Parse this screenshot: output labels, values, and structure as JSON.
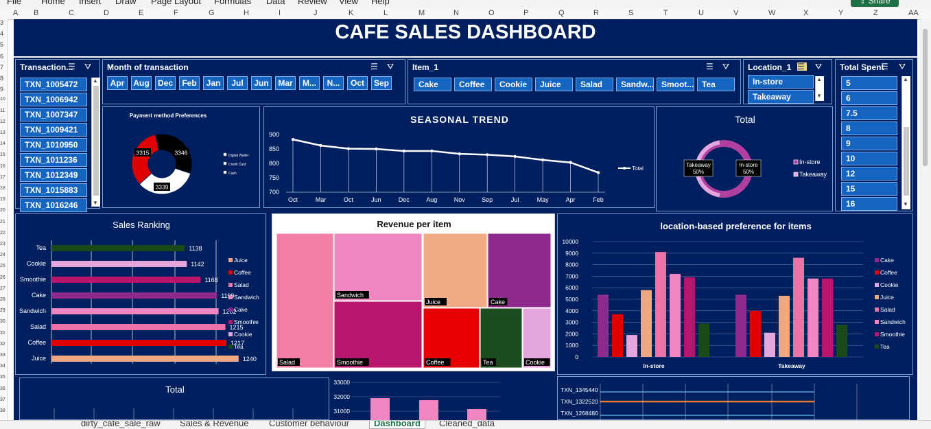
{
  "ribbon": {
    "tabs": [
      "File",
      "Home",
      "Insert",
      "Draw",
      "Page Layout",
      "Formulas",
      "Data",
      "Review",
      "View",
      "Help"
    ],
    "share": "Share"
  },
  "columns": [
    "A",
    "B",
    "C",
    "D",
    "E",
    "F",
    "G",
    "H",
    "I",
    "J",
    "K",
    "L",
    "M",
    "N",
    "O",
    "P",
    "Q",
    "R",
    "S",
    "T",
    "U",
    "V",
    "W",
    "X",
    "Y",
    "Z",
    "AA"
  ],
  "rows": [
    "3",
    "4",
    "5",
    "6",
    "7",
    "8",
    "9",
    "10",
    "11",
    "12",
    "13",
    "14",
    "15",
    "16",
    "17",
    "18",
    "19",
    "20",
    "21",
    "22",
    "23",
    "24",
    "25",
    "26",
    "27",
    "28",
    "29",
    "30",
    "31",
    "32",
    "33",
    "34",
    "35",
    "36",
    "37",
    "38"
  ],
  "title": "CAFE SALES DASHBOARD",
  "slicers": {
    "transaction": {
      "header": "Transaction...",
      "items": [
        "TXN_1005472",
        "TXN_1006942",
        "TXN_1007347",
        "TXN_1009421",
        "TXN_1010950",
        "TXN_1011236",
        "TXN_1012349",
        "TXN_1015883",
        "TXN_1016246"
      ]
    },
    "month": {
      "header": "Month of transaction",
      "items": [
        "Apr",
        "Aug",
        "Dec",
        "Feb",
        "Jan",
        "Jul",
        "Jun",
        "Mar",
        "M...",
        "N...",
        "Oct",
        "Sep"
      ]
    },
    "item": {
      "header": "Item_1",
      "items": [
        "Cake",
        "Coffee",
        "Cookie",
        "Juice",
        "Salad",
        "Sandw...",
        "Smoot...",
        "Tea"
      ]
    },
    "location": {
      "header": "Location_1",
      "items": [
        "In-store",
        "Takeaway"
      ]
    },
    "total_spent": {
      "header": "Total Spent",
      "items": [
        "5",
        "6",
        "7.5",
        "8",
        "9",
        "10",
        "12",
        "15",
        "16"
      ]
    }
  },
  "payment_chart": {
    "title": "Payment method Preferences",
    "chart_data": {
      "type": "pie",
      "categories": [
        "Digital Wallet",
        "Credit Card",
        "Cash"
      ],
      "values": [
        3315,
        3346,
        3339
      ],
      "colors": [
        "#e00000",
        "#000000",
        "#ffffff"
      ]
    }
  },
  "seasonal_chart": {
    "title": "SEASONAL TREND",
    "chart_data": {
      "type": "line",
      "categories": [
        "Oct",
        "Mar",
        "Oct",
        "Jun",
        "Dec",
        "Aug",
        "Nov",
        "Sep",
        "Jul",
        "May",
        "Apr",
        "Feb"
      ],
      "series": [
        {
          "name": "Total",
          "values": [
            883,
            862,
            851,
            850,
            843,
            843,
            833,
            830,
            824,
            812,
            803,
            768
          ]
        }
      ],
      "ylim": [
        700,
        900
      ],
      "yticks": [
        700,
        750,
        800,
        850,
        900
      ]
    }
  },
  "total_chart": {
    "title": "Total",
    "chart_data": {
      "type": "pie",
      "categories": [
        "In-store",
        "Takeaway"
      ],
      "values": [
        50,
        50
      ],
      "colors": [
        "#b03fa0",
        "#e4a6dd"
      ]
    },
    "labels": {
      "instore": "In-store",
      "instore_pct": "50%",
      "takeaway": "Takeaway",
      "takeaway_pct": "50%"
    }
  },
  "sales_ranking": {
    "title": "Sales Ranking",
    "chart_data": {
      "type": "bar",
      "categories": [
        "Tea",
        "Cookie",
        "Smoothie",
        "Cake",
        "Sandwich",
        "Salad",
        "Coffee",
        "Juice"
      ],
      "values": [
        1138,
        1142,
        1168,
        1199,
        1202,
        1215,
        1217,
        1240
      ],
      "colors": [
        "#1a4a1a",
        "#e4a6dd",
        "#b8166d",
        "#8e2a8e",
        "#ef86bf",
        "#ec73a8",
        "#e00000",
        "#f0a884"
      ]
    },
    "legend": [
      "Juice",
      "Coffee",
      "Salad",
      "Sandwich",
      "Cake",
      "Smoothie",
      "Cookie",
      "Tea"
    ],
    "legend_colors": [
      "#f0a884",
      "#e00000",
      "#ec73a8",
      "#ef86bf",
      "#8e2a8e",
      "#b8166d",
      "#e4a6dd",
      "#1a4a1a"
    ]
  },
  "revenue_chart": {
    "title": "Revenue per item",
    "chart_data": {
      "type": "treemap",
      "categories": [
        "Salad",
        "Sandwich",
        "Smoothie",
        "Juice",
        "Cake",
        "Coffee",
        "Tea",
        "Cookie"
      ]
    }
  },
  "location_chart": {
    "title": "location-based preference for items",
    "chart_data": {
      "type": "bar",
      "categories": [
        "In-store",
        "Takeaway"
      ],
      "series": [
        {
          "name": "Cake",
          "values": [
            5400,
            5400
          ],
          "color": "#8e2a8e"
        },
        {
          "name": "Coffee",
          "values": [
            3700,
            4000
          ],
          "color": "#e00000"
        },
        {
          "name": "Cookie",
          "values": [
            1900,
            2100
          ],
          "color": "#e4a6dd"
        },
        {
          "name": "Juice",
          "values": [
            5800,
            5300
          ],
          "color": "#f0a884"
        },
        {
          "name": "Salad",
          "values": [
            9100,
            8600
          ],
          "color": "#ec73a8"
        },
        {
          "name": "Sandwich",
          "values": [
            7200,
            6800
          ],
          "color": "#ef86bf"
        },
        {
          "name": "Smoothie",
          "values": [
            6900,
            6800
          ],
          "color": "#b8166d"
        },
        {
          "name": "Tea",
          "values": [
            2900,
            2800
          ],
          "color": "#1a4a1a"
        }
      ],
      "ylim": [
        0,
        10000
      ],
      "yticks": [
        0,
        1000,
        2000,
        3000,
        4000,
        5000,
        6000,
        7000,
        8000,
        9000,
        10000
      ]
    }
  },
  "bottom_total": {
    "title": "Total"
  },
  "bottom_mid": {
    "chart_data": {
      "type": "bar",
      "ylabels": [
        "33000",
        "32000",
        "31000"
      ]
    }
  },
  "bottom_right": {
    "chart_data": {
      "type": "line",
      "categories": [
        "TXN_1345440",
        "TXN_1322520",
        "TXN_1268480"
      ]
    }
  },
  "sheet_tabs": [
    "dirty_cafe_sale_raw",
    "Sales & Revenue",
    "Customer behaviour",
    "Dashboard",
    "Cleaned_data"
  ]
}
